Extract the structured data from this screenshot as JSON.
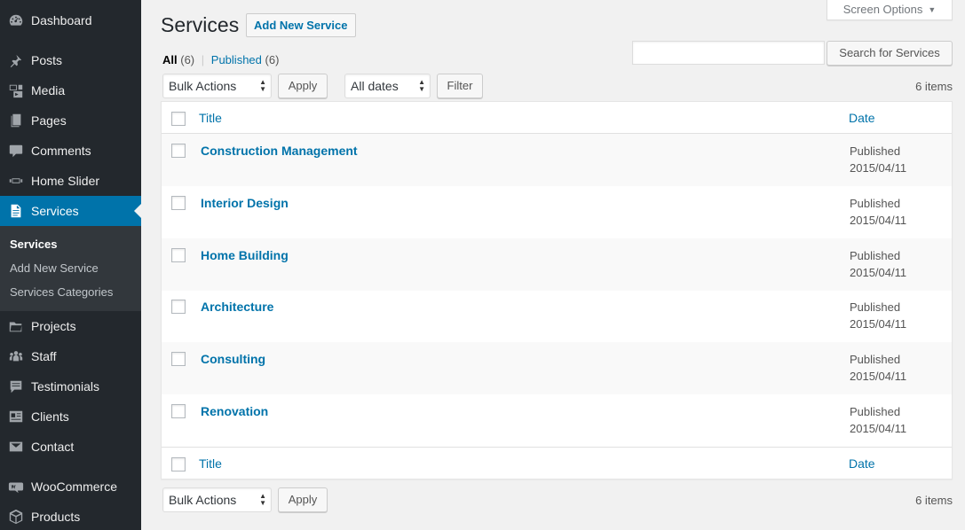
{
  "sidebar": {
    "items": [
      {
        "label": "Dashboard",
        "icon": "dashboard-icon"
      },
      {
        "label": "Posts",
        "icon": "pin-icon"
      },
      {
        "label": "Media",
        "icon": "media-icon"
      },
      {
        "label": "Pages",
        "icon": "pages-icon"
      },
      {
        "label": "Comments",
        "icon": "comment-icon"
      },
      {
        "label": "Home Slider",
        "icon": "slider-icon"
      },
      {
        "label": "Services",
        "icon": "document-icon"
      },
      {
        "label": "Projects",
        "icon": "folder-icon"
      },
      {
        "label": "Staff",
        "icon": "groups-icon"
      },
      {
        "label": "Testimonials",
        "icon": "testimonial-icon"
      },
      {
        "label": "Clients",
        "icon": "id-card-icon"
      },
      {
        "label": "Contact",
        "icon": "email-icon"
      },
      {
        "label": "WooCommerce",
        "icon": "woo-icon"
      },
      {
        "label": "Products",
        "icon": "product-box-icon"
      }
    ],
    "submenu": [
      "Services",
      "Add New Service",
      "Services Categories"
    ]
  },
  "header": {
    "title": "Services",
    "add_new": "Add New Service",
    "screen_options": "Screen Options"
  },
  "filters": {
    "all_label": "All",
    "all_count": "(6)",
    "separator": "|",
    "published_label": "Published",
    "published_count": "(6)"
  },
  "search": {
    "value": "",
    "button": "Search for Services"
  },
  "toolbar": {
    "bulk_actions": "Bulk Actions",
    "apply": "Apply",
    "dates": "All dates",
    "filter": "Filter",
    "items_count": "6 items"
  },
  "table": {
    "col_title": "Title",
    "col_date": "Date",
    "rows": [
      {
        "title": "Construction Management",
        "status": "Published",
        "date": "2015/04/11"
      },
      {
        "title": "Interior Design",
        "status": "Published",
        "date": "2015/04/11"
      },
      {
        "title": "Home Building",
        "status": "Published",
        "date": "2015/04/11"
      },
      {
        "title": "Architecture",
        "status": "Published",
        "date": "2015/04/11"
      },
      {
        "title": "Consulting",
        "status": "Published",
        "date": "2015/04/11"
      },
      {
        "title": "Renovation",
        "status": "Published",
        "date": "2015/04/11"
      }
    ]
  },
  "colors": {
    "sidebar_bg": "#23282d",
    "accent": "#0073aa",
    "submenu_bg": "#32373c"
  }
}
